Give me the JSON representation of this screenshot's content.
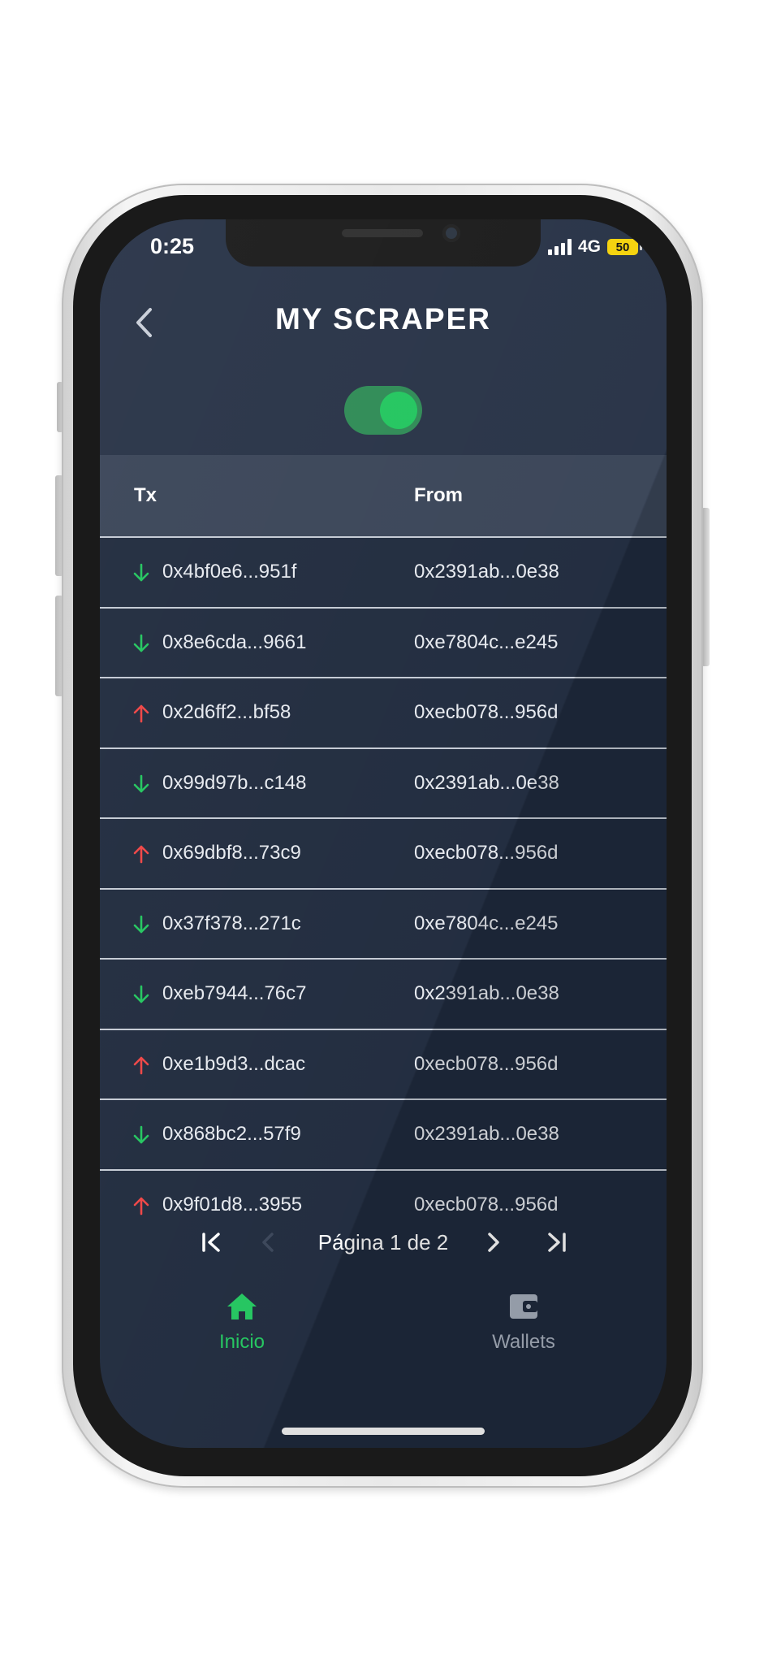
{
  "status_bar": {
    "time": "0:25",
    "network": "4G",
    "battery": "50"
  },
  "header": {
    "title": "MY SCRAPER",
    "back_icon": "chevron-left-icon",
    "toggle_on": true
  },
  "table": {
    "columns": [
      "Tx",
      "From"
    ],
    "rows": [
      {
        "direction": "in",
        "tx": "0x4bf0e6...951f",
        "from": "0x2391ab...0e38"
      },
      {
        "direction": "in",
        "tx": "0x8e6cda...9661",
        "from": "0xe7804c...e245"
      },
      {
        "direction": "out",
        "tx": "0x2d6ff2...bf58",
        "from": "0xecb078...956d"
      },
      {
        "direction": "in",
        "tx": "0x99d97b...c148",
        "from": "0x2391ab...0e38"
      },
      {
        "direction": "out",
        "tx": "0x69dbf8...73c9",
        "from": "0xecb078...956d"
      },
      {
        "direction": "in",
        "tx": "0x37f378...271c",
        "from": "0xe7804c...e245"
      },
      {
        "direction": "in",
        "tx": "0xeb7944...76c7",
        "from": "0x2391ab...0e38"
      },
      {
        "direction": "out",
        "tx": "0xe1b9d3...dcac",
        "from": "0xecb078...956d"
      },
      {
        "direction": "in",
        "tx": "0x868bc2...57f9",
        "from": "0x2391ab...0e38"
      },
      {
        "direction": "out",
        "tx": "0x9f01d8...3955",
        "from": "0xecb078...956d"
      }
    ]
  },
  "pagination": {
    "label": "Página 1 de 2"
  },
  "bottom_nav": {
    "items": [
      {
        "label": "Inicio",
        "icon": "home-icon",
        "active": true
      },
      {
        "label": "Wallets",
        "icon": "wallet-icon",
        "active": false
      }
    ]
  },
  "colors": {
    "accent": "#22c55e",
    "incoming": "#22c55e",
    "outgoing": "#ef4444",
    "background": "#1f2a3d",
    "header": "#273246",
    "table_header": "#394457"
  }
}
